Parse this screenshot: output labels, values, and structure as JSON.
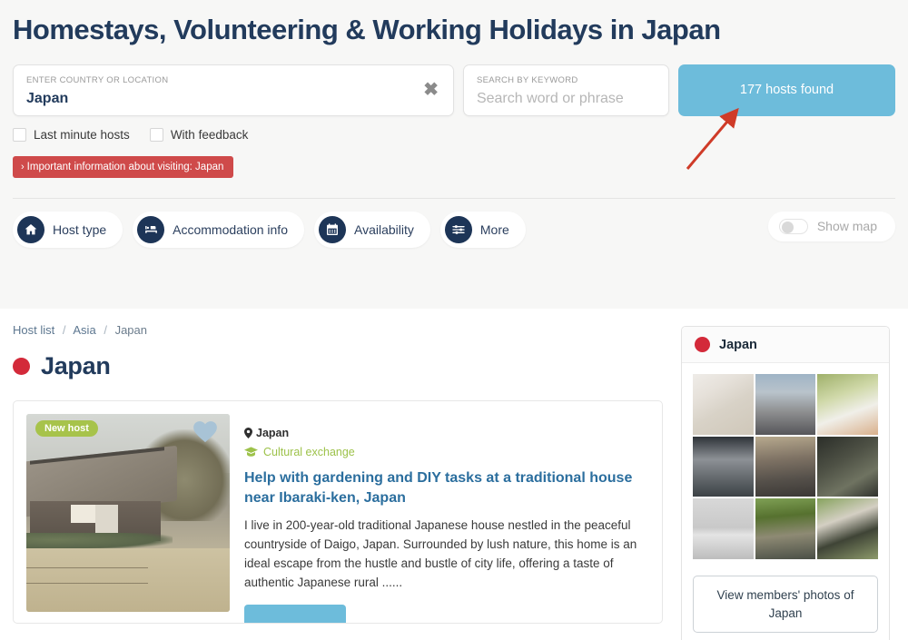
{
  "header": {
    "title": "Homestays, Volunteering & Working Holidays in Japan"
  },
  "search": {
    "location_label": "ENTER COUNTRY OR LOCATION",
    "location_value": "Japan",
    "clear_icon": "close-x-icon",
    "keyword_label": "SEARCH BY KEYWORD",
    "keyword_placeholder": "Search word or phrase",
    "keyword_value": "",
    "results_button": "177 hosts found",
    "results_count": 177,
    "results_button_color": "#6dbcdb"
  },
  "checkboxes": [
    {
      "label": "Last minute hosts",
      "checked": false
    },
    {
      "label": "With feedback",
      "checked": false
    }
  ],
  "alert": {
    "chevron": "›",
    "text": "Important information about visiting: Japan",
    "color": "#cf4a4a"
  },
  "filters": {
    "chips": [
      {
        "label": "Host type",
        "icon": "home-icon"
      },
      {
        "label": "Accommodation info",
        "icon": "bed-icon"
      },
      {
        "label": "Availability",
        "icon": "calendar-icon"
      },
      {
        "label": "More",
        "icon": "sliders-icon"
      }
    ],
    "show_map": {
      "label": "Show map",
      "on": false
    }
  },
  "breadcrumb": {
    "items": [
      "Host list",
      "Asia",
      "Japan"
    ],
    "separator": "/"
  },
  "country": {
    "name": "Japan",
    "flag_color": "#d32a3a"
  },
  "listing": {
    "badge": "New host",
    "badge_color": "#a7c34b",
    "favourite_icon": "heart-icon",
    "location_icon": "map-pin-icon",
    "location": "Japan",
    "tag_icon": "graduation-cap-icon",
    "tag": "Cultural exchange",
    "tag_color": "#9dc24a",
    "title": "Help with gardening and DIY tasks at a traditional house near Ibaraki-ken, Japan",
    "description": "I live in 200-year-old traditional Japanese house nestled in the peaceful countryside of Daigo, Japan. Surrounded by lush nature, this home is an ideal escape from the hustle and bustle of city life, offering a taste of authentic Japanese rural ......",
    "cta_label": ""
  },
  "sidebar": {
    "panel_title": "Japan",
    "flag_color": "#d32a3a",
    "photos": [
      {
        "alt": "maneki-neko cat figurines"
      },
      {
        "alt": "Tokyo street with tower"
      },
      {
        "alt": "white cat statue close up"
      },
      {
        "alt": "train station platform"
      },
      {
        "alt": "narrow street at dusk"
      },
      {
        "alt": "bare trees through window"
      },
      {
        "alt": "misty lake"
      },
      {
        "alt": "garden table with plants"
      },
      {
        "alt": "fresh produce on table"
      }
    ],
    "view_photos_button": "View members' photos of Japan"
  },
  "annotation": {
    "arrow_color": "#cf3b28",
    "points_at": "177 hosts found"
  }
}
